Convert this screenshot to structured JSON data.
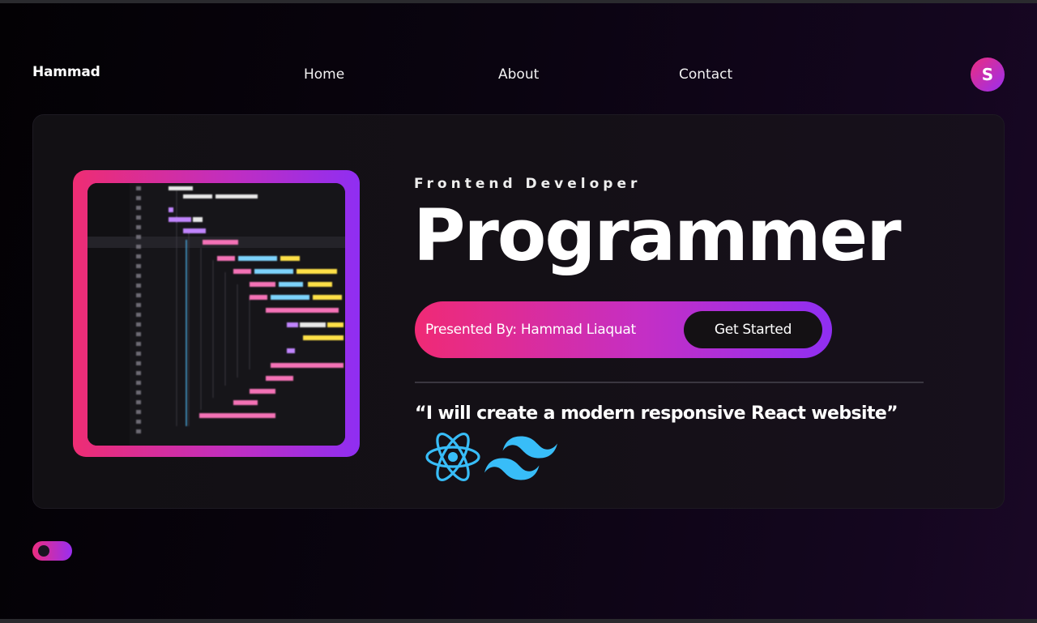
{
  "nav": {
    "brand": "Hammad",
    "links": [
      "Home",
      "About",
      "Contact"
    ],
    "avatar_letter": "S"
  },
  "hero": {
    "subtitle": "Frontend Developer",
    "headline": "Programmer",
    "presented_by": "Presented By: Hammad Liaquat",
    "cta_label": "Get Started",
    "quote": "“I will create a modern responsive React website”",
    "tech_icons": [
      "react-icon",
      "tailwind-icon"
    ]
  },
  "theme_toggle": {
    "state": "dark"
  },
  "colors": {
    "accent_pink": "#ec2d7f",
    "accent_purple": "#9a2ef0",
    "card_bg": "#141016",
    "react_blue": "#38bdf8",
    "tailwind_teal": "#38bdf8"
  }
}
